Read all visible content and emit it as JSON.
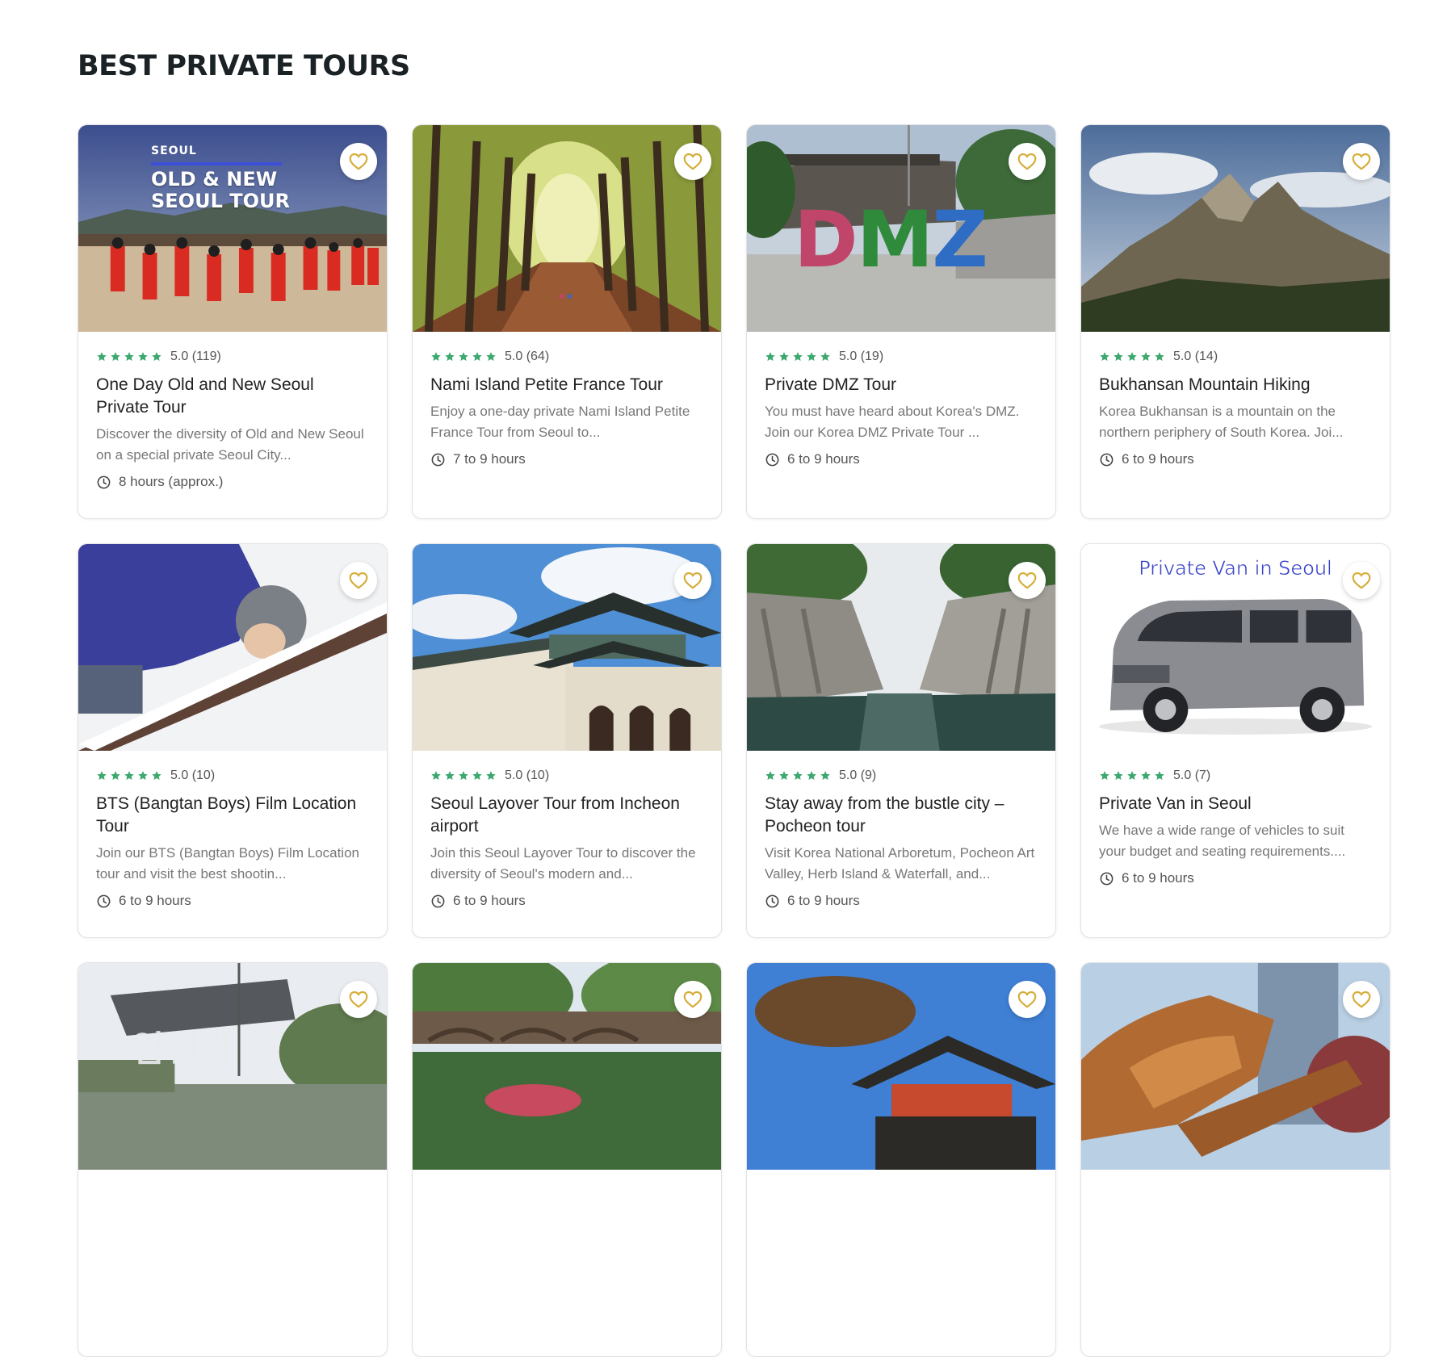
{
  "section": {
    "title": "BEST PRIVATE TOURS"
  },
  "colors": {
    "star": "#3da86f",
    "heart": "#d6ad3a",
    "title_text": "#1b2226"
  },
  "icons": {
    "favorite": "heart-outline-icon",
    "rating": "star-icon",
    "duration": "clock-icon"
  },
  "tours": [
    {
      "overlay": {
        "city": "SEOUL",
        "line1": "OLD & NEW",
        "line2": "SEOUL TOUR"
      },
      "rating": 5,
      "score": "5.0 (119)",
      "title": "One Day Old and New Seoul Private Tour",
      "desc": "Discover the diversity of Old and New Seoul on a special private Seoul City...",
      "duration": "8 hours (approx.)"
    },
    {
      "rating": 5,
      "score": "5.0 (64)",
      "title": "Nami Island Petite France Tour",
      "desc": "Enjoy a one-day private Nami Island Petite France Tour from Seoul to...",
      "duration": "7 to 9 hours"
    },
    {
      "overlay": {
        "letters": "DMZ"
      },
      "rating": 5,
      "score": "5.0 (19)",
      "title": "Private DMZ Tour",
      "desc": "You must have heard about Korea's DMZ. Join our Korea DMZ Private Tour ...",
      "duration": "6 to 9 hours"
    },
    {
      "rating": 5,
      "score": "5.0 (14)",
      "title": "Bukhansan Mountain Hiking",
      "desc": "Korea Bukhansan is a mountain on the northern periphery of South Korea. Joi...",
      "duration": "6 to 9 hours"
    },
    {
      "rating": 5,
      "score": "5.0 (10)",
      "title": "BTS (Bangtan Boys) Film Location Tour",
      "desc": "Join our BTS (Bangtan Boys) Film Location tour and visit the best shootin...",
      "duration": "6 to 9 hours"
    },
    {
      "rating": 5,
      "score": "5.0 (10)",
      "title": "Seoul Layover Tour from Incheon airport",
      "desc": "Join this Seoul Layover Tour to discover the diversity of Seoul's modern and...",
      "duration": "6 to 9 hours"
    },
    {
      "rating": 5,
      "score": "5.0 (9)",
      "title": "Stay away from the bustle city – Pocheon tour",
      "desc": "Visit Korea National Arboretum, Pocheon Art Valley, Herb Island & Waterfall, and...",
      "duration": "6 to 9 hours"
    },
    {
      "overlay": {
        "caption": "Private Van in Seoul"
      },
      "rating": 5,
      "score": "5.0 (7)",
      "title": "Private Van in Seoul",
      "desc": "We have a wide range of vehicles to suit your budget and seating requirements....",
      "duration": "6 to 9 hours"
    },
    {
      "overlay": {
        "sign": "임진각"
      }
    },
    {},
    {},
    {}
  ]
}
